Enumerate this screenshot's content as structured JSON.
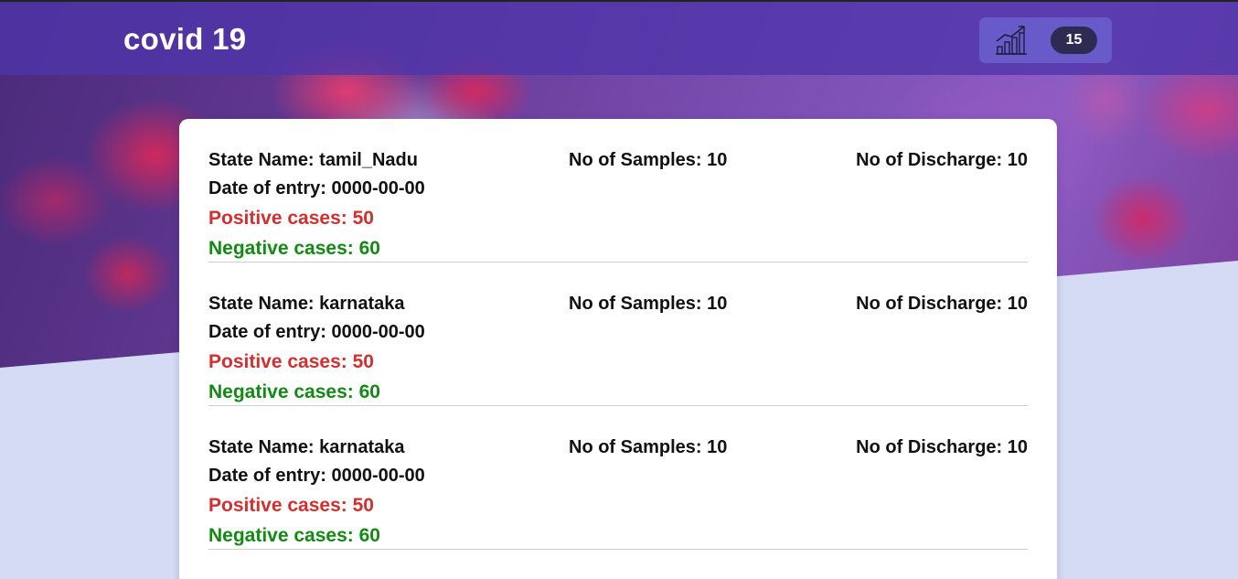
{
  "header": {
    "brand": "covid 19",
    "stat_icon": "chart-growth-icon",
    "stat_count": "15"
  },
  "records": [
    {
      "state": "State Name: tamil_Nadu",
      "date": "Date of entry: 0000-00-00",
      "positive": "Positive cases: 50",
      "negative": "Negative cases: 60",
      "samples": "No of Samples: 10",
      "discharge": "No of Discharge: 10"
    },
    {
      "state": "State Name: karnataka",
      "date": "Date of entry: 0000-00-00",
      "positive": "Positive cases: 50",
      "negative": "Negative cases: 60",
      "samples": "No of Samples: 10",
      "discharge": "No of Discharge: 10"
    },
    {
      "state": "State Name: karnataka",
      "date": "Date of entry: 0000-00-00",
      "positive": "Positive cases: 50",
      "negative": "Negative cases: 60",
      "samples": "No of Samples: 10",
      "discharge": "No of Discharge: 10"
    }
  ],
  "colors": {
    "topbar": "#4e34aa",
    "positive": "#d32f2f",
    "negative": "#138a13",
    "badge": "#2d2b52",
    "page_background": "#d6dbf5"
  }
}
